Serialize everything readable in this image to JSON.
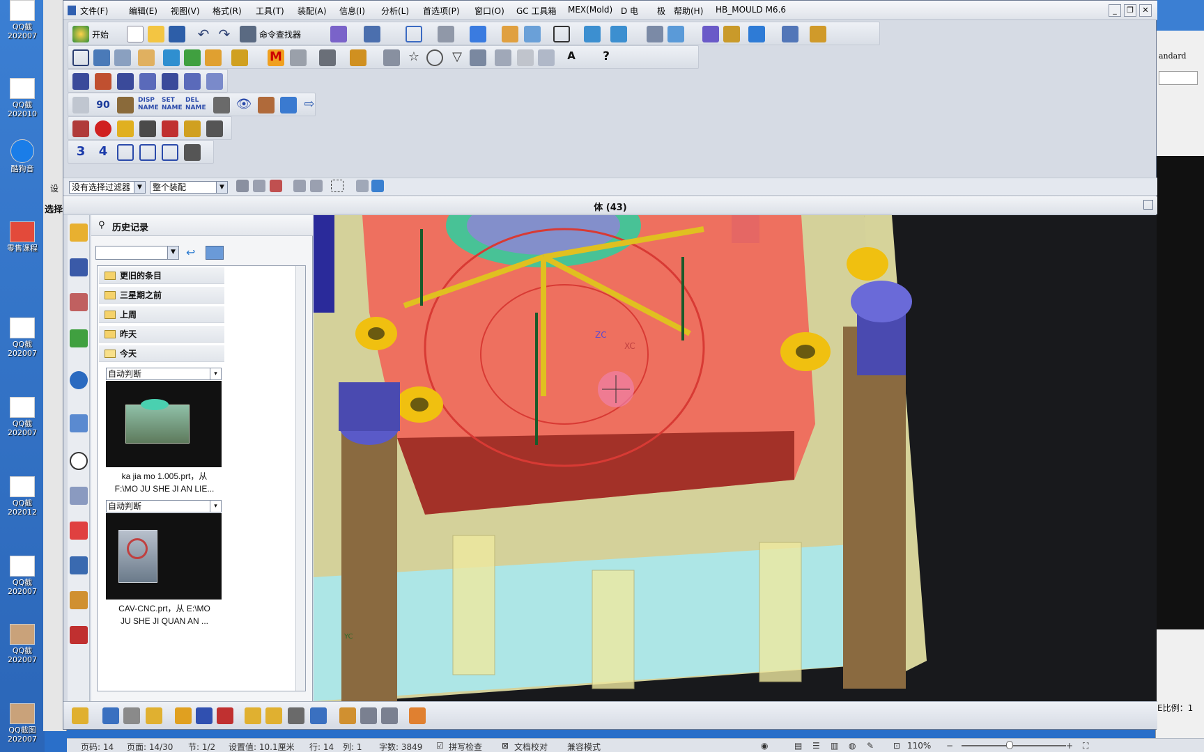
{
  "desktop": {
    "icons": [
      {
        "label": "QQ截\n202007"
      },
      {
        "label": "QQ截\n202010"
      },
      {
        "label": "酷狗音"
      },
      {
        "label": "零售课程"
      },
      {
        "label": "QQ截\n202007"
      },
      {
        "label": "QQ截\n202007"
      },
      {
        "label": "QQ截\n202012"
      },
      {
        "label": "QQ截\n202007"
      },
      {
        "label": "QQ截\n202007"
      },
      {
        "label": "QQ截图\n202007"
      }
    ]
  },
  "background_left": {
    "label_1": "设",
    "label_2": "选择"
  },
  "background_right": {
    "text_1": "andard",
    "text_2": "E比例：1"
  },
  "menubar": {
    "items": [
      "文件(F)",
      "编辑(E)",
      "视图(V)",
      "格式(R)",
      "工具(T)",
      "装配(A)",
      "信息(I)",
      "分析(L)",
      "首选项(P)",
      "窗口(O)",
      "GC 工具箱",
      "MEX(Mold)",
      "D 电",
      "极",
      "帮助(H)",
      "HB_MOULD M6.6"
    ]
  },
  "toolbar": {
    "start_label": "开始",
    "command_finder_label": "命令查找器"
  },
  "toolbar2": {
    "disp_name": "DISP\nNAME",
    "set_name": "SET\nNAME",
    "del_name": "DEL\nNAME",
    "num3": "3",
    "num4": "4"
  },
  "selection_bar": {
    "filter": "没有选择过滤器",
    "scope": "整个装配"
  },
  "view_title": "体 (43)",
  "history": {
    "title": "历史记录",
    "groups": [
      "更旧的条目",
      "三星期之前",
      "上周",
      "昨天",
      "今天"
    ],
    "entries": [
      {
        "mode": "自动判断",
        "filename": "ka jia mo 1.005.prt，从",
        "path": "F:\\MO JU SHE JI AN LIE..."
      },
      {
        "mode": "自动判断",
        "filename": "CAV-CNC.prt，从 E:\\MO",
        "path": "JU  SHE  JI  QUAN  AN ..."
      }
    ]
  },
  "viewport": {
    "axis_zc": "ZC",
    "axis_xc": "XC",
    "axis_yc": "YC"
  },
  "statusbar": {
    "page": "页码: 14",
    "pages": "页面: 14/30",
    "section": "节: 1/2",
    "setting": "设置值: 10.1厘米",
    "row": "行: 14",
    "col": "列: 1",
    "words": "字数: 3849",
    "spell": "拼写检查",
    "proof": "文档校对",
    "compat": "兼容模式",
    "zoom": "110%"
  },
  "colors": {
    "accent": "#e5553e",
    "plate": "#f1ee9a",
    "pin": "#6e6bd4"
  }
}
